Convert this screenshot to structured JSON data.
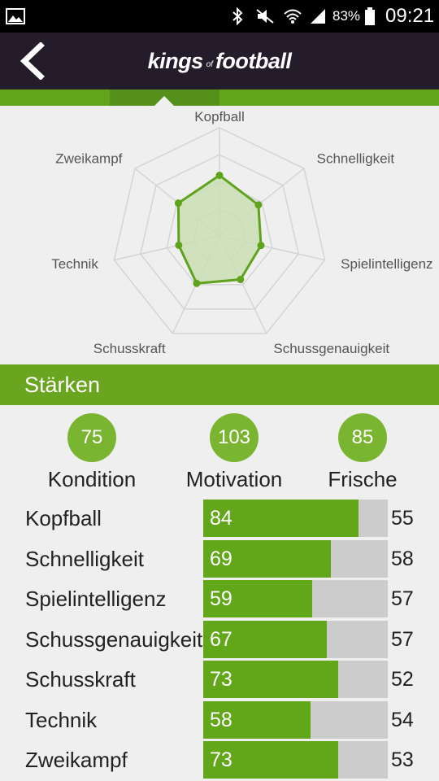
{
  "status_bar": {
    "battery_text": "83%",
    "time": "09:21",
    "icons": [
      "image-icon",
      "bluetooth-icon",
      "mute-icon",
      "wifi-icon",
      "signal-icon",
      "battery-icon"
    ]
  },
  "app_bar": {
    "back_icon": "back-arrow-icon",
    "logo_kings": "kings",
    "logo_of": "of",
    "logo_football": "football"
  },
  "radar": {
    "labels": [
      "Kopfball",
      "Schnelligkeit",
      "Spielintelligenz",
      "Schussgenauigkeit",
      "Schusskraft",
      "Technik",
      "Zweikampf"
    ],
    "values": [
      84,
      69,
      59,
      67,
      73,
      58,
      73
    ],
    "max": 150,
    "rings": 4,
    "colors": {
      "line": "#5fa31c",
      "fill": "#c9deb4",
      "grid": "#d4d4d4",
      "label": "#555555"
    }
  },
  "section": {
    "title": "Stärken"
  },
  "summary": [
    {
      "value": "75",
      "label": "Kondition"
    },
    {
      "value": "103",
      "label": "Motivation"
    },
    {
      "value": "85",
      "label": "Frische"
    }
  ],
  "attributes": [
    {
      "name": "Kopfball",
      "value": "84",
      "compare": "55"
    },
    {
      "name": "Schnelligkeit",
      "value": "69",
      "compare": "58"
    },
    {
      "name": "Spielintelligenz",
      "value": "59",
      "compare": "57"
    },
    {
      "name": "Schussgenauigkeit",
      "value": "67",
      "compare": "57"
    },
    {
      "name": "Schusskraft",
      "value": "73",
      "compare": "52"
    },
    {
      "name": "Technik",
      "value": "58",
      "compare": "54"
    },
    {
      "name": "Zweikampf",
      "value": "73",
      "compare": "53"
    }
  ],
  "bar_max": 100,
  "colors": {
    "accent": "#69a51f",
    "bar_fill": "#62a71a",
    "bar_track": "#cccccc",
    "app_bar": "#241c2b"
  }
}
